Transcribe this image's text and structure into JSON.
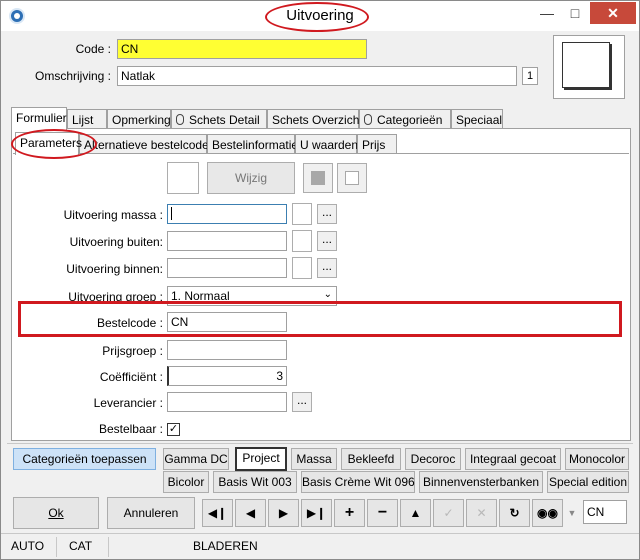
{
  "window": {
    "title": "Uitvoering"
  },
  "header": {
    "code_label": "Code :",
    "code_value": "CN",
    "omschrijving_label": "Omschrijving :",
    "omschrijving_value": "Natlak",
    "counter": "1"
  },
  "main_tabs": [
    "Formulier",
    "Lijst",
    "Opmerking",
    "Schets Detail",
    "Schets Overzicht",
    "Categorieën",
    "Speciaal"
  ],
  "sub_tabs": [
    "Parameters",
    "Alternatieve bestelcodes",
    "Bestelinformatie",
    "U waarden",
    "Prijs"
  ],
  "wijzig_label": "Wijzig",
  "form": {
    "massa_label": "Uitvoering massa :",
    "buiten_label": "Uitvoering buiten:",
    "binnen_label": "Uitvoering binnen:",
    "groep_label": "Uitvoering groep :",
    "groep_value": "1.  Normaal",
    "bestelcode_label": "Bestelcode :",
    "bestelcode_value": "CN",
    "prijsgroep_label": "Prijsgroep :",
    "coefficient_label": "Coëfficiënt :",
    "coefficient_value": "3",
    "leverancier_label": "Leverancier :",
    "bestelbaar_label": "Bestelbaar :",
    "bestelbaar_checked": true,
    "dots": "..."
  },
  "categories": {
    "apply_label": "Categorieën toepassen",
    "row1": [
      "Gamma DC",
      "Project",
      "Massa",
      "Bekleefd",
      "Decoroc",
      "Integraal gecoat",
      "Monocolor"
    ],
    "row2": [
      "Bicolor",
      "Basis Wit 003",
      "Basis Crème Wit 096",
      "Binnenvensterbanken",
      "Special edition"
    ]
  },
  "bottom": {
    "ok_label": "Ok",
    "annuleren_label": "Annuleren",
    "code_value": "CN"
  },
  "status": {
    "auto": "AUTO",
    "cat": "CAT",
    "mode": "BLADEREN"
  }
}
